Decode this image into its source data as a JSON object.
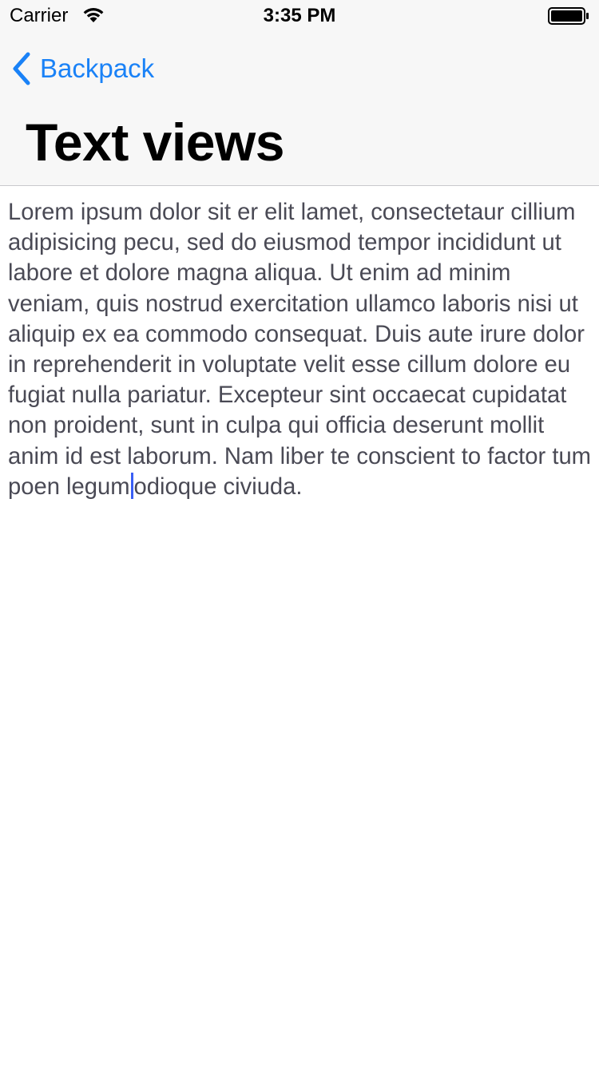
{
  "status_bar": {
    "carrier": "Carrier",
    "time": "3:35 PM",
    "wifi_icon": "wifi-icon",
    "battery_icon": "battery-full-icon"
  },
  "nav": {
    "back_label": "Backpack",
    "back_icon": "chevron-left-icon",
    "title": "Text views"
  },
  "text_view": {
    "before_caret": "Lorem ipsum dolor sit er elit lamet, consectetaur cillium adipisicing pecu, sed do eiusmod tempor incididunt ut labore et dolore magna aliqua. Ut enim ad minim veniam, quis nostrud exercitation ullamco laboris nisi ut aliquip ex ea commodo consequat. Duis aute irure dolor in reprehenderit in voluptate velit esse cillum dolore eu fugiat nulla pariatur. Excepteur sint occaecat cupidatat non proident, sunt in culpa qui officia deserunt mollit anim id est laborum. Nam liber te conscient to factor tum poen legum",
    "after_caret": "odioque civiuda."
  },
  "colors": {
    "accent": "#1a82f7",
    "bar_background": "#f7f7f7",
    "body_text": "#4a4a55",
    "caret": "#3a5ff5"
  }
}
